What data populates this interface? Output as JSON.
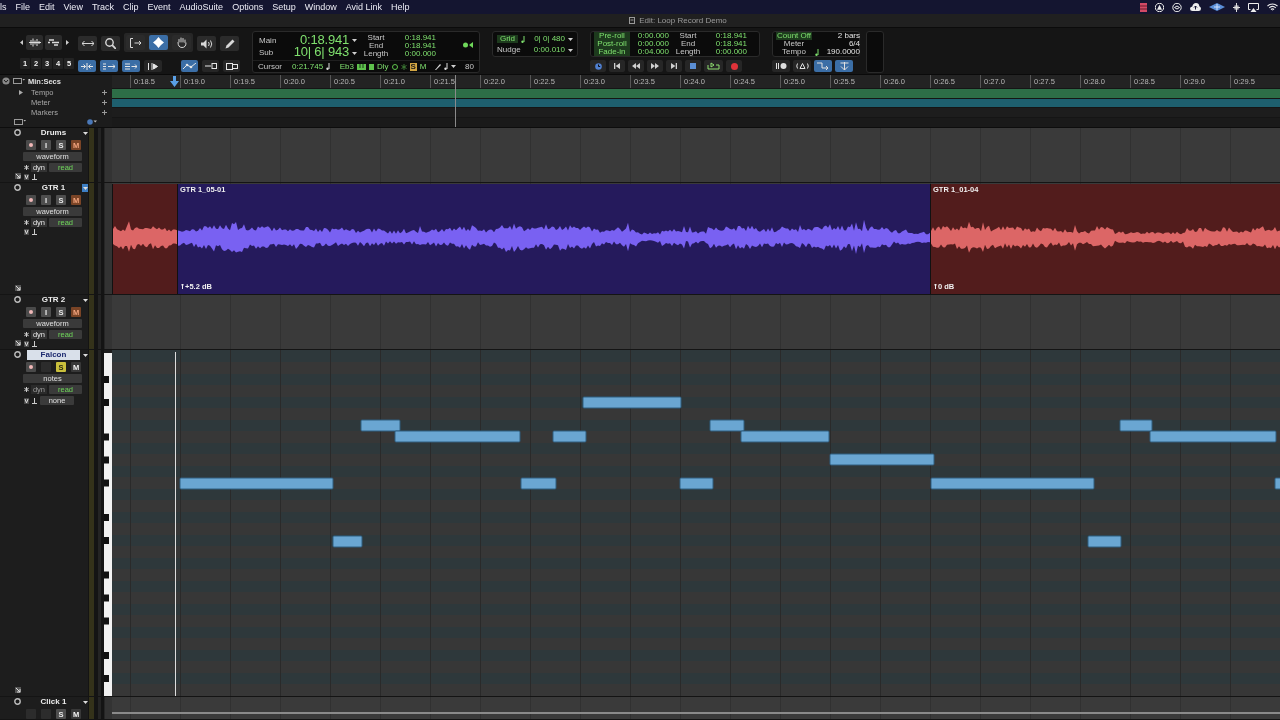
{
  "menu_bar": {
    "items": [
      "ls",
      "File",
      "Edit",
      "View",
      "Track",
      "Clip",
      "Event",
      "AudioSuite",
      "Options",
      "Setup",
      "Window",
      "Avid Link",
      "Help"
    ]
  },
  "window": {
    "title": "Edit: Loop Record Demo"
  },
  "toolbar": {
    "zoom_presets": [
      "1",
      "2",
      "3",
      "4",
      "5"
    ],
    "edit_tools": [
      {
        "kind": "zoom_toggle",
        "selected": false
      },
      {
        "kind": "zoomer",
        "selected": false
      },
      {
        "kind": "trim",
        "selected": false
      },
      {
        "kind": "grabber",
        "selected": true
      },
      {
        "kind": "hand",
        "selected": false
      },
      {
        "kind": "scrubber",
        "selected": false
      },
      {
        "kind": "pencil",
        "selected": false
      }
    ],
    "edit_modes": [
      {
        "kind": "shuffle",
        "on": true
      },
      {
        "kind": "spot",
        "on": true
      },
      {
        "kind": "slip",
        "on": true
      },
      {
        "kind": "grid",
        "on": false
      }
    ],
    "link_options": [
      {
        "kind": "link",
        "on": true
      },
      {
        "kind": "insertion",
        "on": false
      },
      {
        "kind": "keyboard",
        "on": false
      }
    ],
    "counter": {
      "rows": [
        {
          "label": "Main",
          "value": "0:18.941"
        },
        {
          "label": "Sub",
          "value": "10| 6| 943"
        }
      ],
      "selection": [
        {
          "label": "Start",
          "value": "0:18.941"
        },
        {
          "label": "End",
          "value": "0:18.941"
        },
        {
          "label": "Length",
          "value": "0:00.000"
        }
      ],
      "cursor_label": "Cursor",
      "cursor_value": "0:21.745",
      "pitch": "Eb3",
      "delay_label": "Dly",
      "solo_label": "S",
      "mute_label": "M",
      "velocity": "80"
    },
    "grid": {
      "label": "Grid",
      "on": true,
      "value": "0| 0| 480"
    },
    "nudge": {
      "label": "Nudge",
      "value": "0:00.010"
    },
    "rolls": [
      {
        "label": "Pre-roll",
        "value": "0:00.000"
      },
      {
        "label": "Post-roll",
        "value": "0:00.000"
      },
      {
        "label": "Fade-in",
        "value": "0:04.000"
      }
    ],
    "transport_selection": [
      {
        "label": "Start",
        "value": "0:18.941"
      },
      {
        "label": "End",
        "value": "0:18.941"
      },
      {
        "label": "Length",
        "value": "0:00.000"
      }
    ],
    "transport_buttons": [
      {
        "kind": "online"
      },
      {
        "kind": "to_start"
      },
      {
        "kind": "rewind"
      },
      {
        "kind": "fast_forward"
      },
      {
        "kind": "to_end"
      },
      {
        "kind": "stop"
      },
      {
        "kind": "loop_play"
      },
      {
        "kind": "record"
      }
    ],
    "midi_settings": [
      {
        "label": "Count Off",
        "value": "2 bars",
        "highlighted": true
      },
      {
        "label": "Meter",
        "value": "6/4",
        "highlighted": false
      },
      {
        "label": "Tempo",
        "value": "190.0000",
        "highlighted": false
      }
    ],
    "midi_buttons": [
      {
        "kind": "metronome",
        "on": false
      },
      {
        "kind": "merge",
        "on": false
      },
      {
        "kind": "wait_for_note",
        "on": true
      },
      {
        "kind": "midi_input",
        "on": true
      }
    ]
  },
  "ruler": {
    "format": "Min:Secs",
    "rows": [
      {
        "label": "Tempo",
        "expandable": true
      },
      {
        "label": "Meter",
        "expandable": false
      },
      {
        "label": "Markers",
        "expandable": false
      }
    ],
    "ticks": [
      "0:18.5",
      "0:19.0",
      "0:19.5",
      "0:20.0",
      "0:20.5",
      "0:21.0",
      "0:21.5",
      "0:22.0",
      "0:22.5",
      "0:23.0",
      "0:23.5",
      "0:24.0",
      "0:24.5",
      "0:25.0",
      "0:25.5",
      "0:26.0",
      "0:26.5",
      "0:27.0",
      "0:27.5",
      "0:28.0",
      "0:28.5",
      "0:29.0",
      "0:29.5"
    ]
  },
  "tracks": [
    {
      "kind": "audio",
      "name": "Drums",
      "name_selected": false,
      "menu_highlighted": false,
      "buttons": [
        {
          "kind": "record",
          "on": false
        },
        {
          "kind": "input",
          "label": "I",
          "on": false
        },
        {
          "kind": "solo",
          "label": "S",
          "on": false
        },
        {
          "kind": "mute",
          "label": "M",
          "on": true
        }
      ],
      "view": "waveform",
      "dyn": "dyn",
      "dyn_disabled": false,
      "automation": "read"
    },
    {
      "kind": "audio",
      "name": "GTR 1",
      "name_selected": false,
      "menu_highlighted": true,
      "buttons": [
        {
          "kind": "record",
          "on": false
        },
        {
          "kind": "input",
          "label": "I",
          "on": false
        },
        {
          "kind": "solo",
          "label": "S",
          "on": false
        },
        {
          "kind": "mute",
          "label": "M",
          "on": true
        }
      ],
      "view": "waveform",
      "dyn": "dyn",
      "dyn_disabled": false,
      "automation": "read",
      "clips": [
        {
          "color": "#521c1c"
        },
        {
          "name": "GTR 1_05-01",
          "gain": "+5.2 dB",
          "color": "#251a5c"
        },
        {
          "name": "GTR 1_01-04",
          "gain": "0 dB",
          "color": "#521c1c"
        }
      ]
    },
    {
      "kind": "audio",
      "name": "GTR 2",
      "name_selected": false,
      "menu_highlighted": false,
      "buttons": [
        {
          "kind": "record",
          "on": false
        },
        {
          "kind": "input",
          "label": "I",
          "on": false
        },
        {
          "kind": "solo",
          "label": "S",
          "on": false
        },
        {
          "kind": "mute",
          "label": "M",
          "on": true
        }
      ],
      "view": "waveform",
      "dyn": "dyn",
      "dyn_disabled": false,
      "automation": "read"
    },
    {
      "kind": "midi",
      "name": "Falcon",
      "name_selected": true,
      "menu_highlighted": false,
      "buttons": [
        {
          "kind": "record",
          "on": false
        },
        {
          "kind": "blank"
        },
        {
          "kind": "solo",
          "label": "S",
          "on": true
        },
        {
          "kind": "mute",
          "label": "M",
          "on": false
        }
      ],
      "view": "notes",
      "dyn": "dyn",
      "dyn_disabled": true,
      "automation": "read",
      "output": "none"
    },
    {
      "kind": "click",
      "name": "Click 1",
      "name_selected": false,
      "menu_highlighted": false,
      "buttons": [
        {
          "kind": "blank"
        },
        {
          "kind": "blank"
        },
        {
          "kind": "solo",
          "label": "S",
          "on": false
        },
        {
          "kind": "mute",
          "label": "M",
          "on": false
        }
      ]
    }
  ]
}
